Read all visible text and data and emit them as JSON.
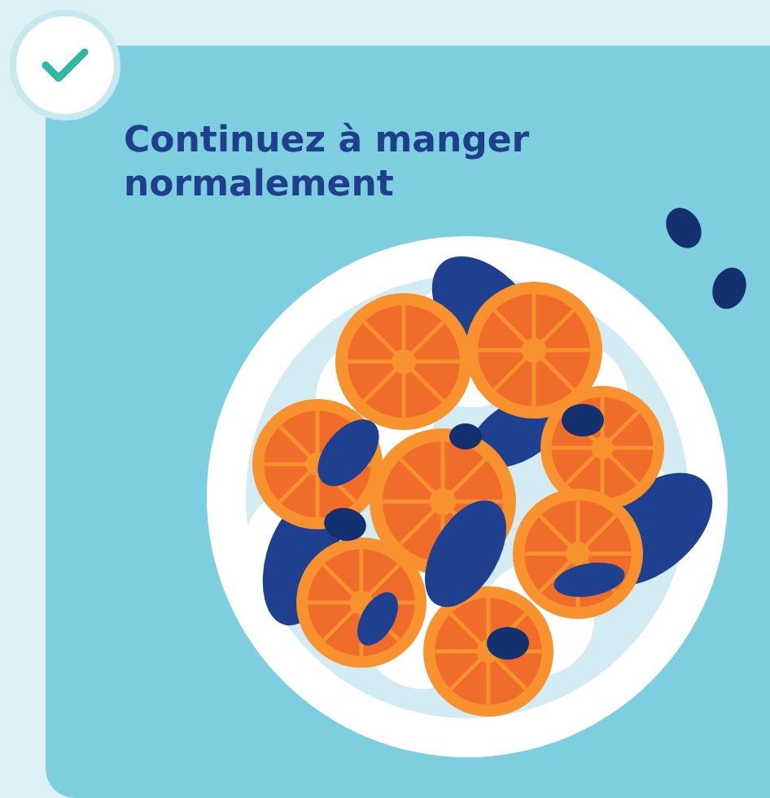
{
  "badge": {
    "checked": true
  },
  "card": {
    "title": "Continuez à manger normalement"
  }
}
